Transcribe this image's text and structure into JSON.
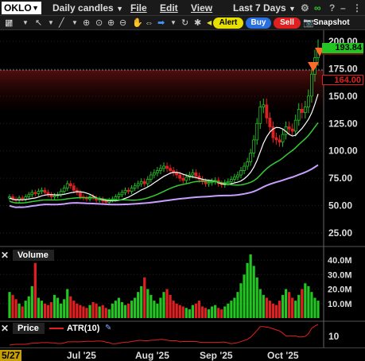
{
  "topbar": {
    "symbol": "OKLO",
    "interval": "Daily candles",
    "menus": [
      "File",
      "Edit",
      "View"
    ],
    "range": "Last 7 Days"
  },
  "toolbar": {
    "alert_label": "Alert",
    "buy_label": "Buy",
    "sell_label": "Sell",
    "snapshot_label": "Snapshot"
  },
  "price_axis": {
    "ticks": [
      "200.00",
      "175.00",
      "150.00",
      "125.00",
      "100.00",
      "75.00",
      "50.00",
      "25.00"
    ],
    "last_price": "193.84",
    "level_label": "164.00",
    "level_label_behind": "168.00",
    "last_price_color": "#22c522",
    "level_color": "#e02020"
  },
  "volume_panel": {
    "tab_label": "Volume",
    "ticks": [
      "40.0M",
      "30.0M",
      "20.0M",
      "10.0M"
    ]
  },
  "indicator_panel": {
    "price_label": "Price",
    "atr_label": "ATR(10)",
    "tick": "10"
  },
  "date_axis": {
    "labels": [
      "5/27",
      "Jul '25",
      "Aug '25",
      "Sep '25",
      "Oct '25"
    ]
  },
  "colors": {
    "up": "#22c522",
    "down": "#e02020",
    "ma_fast": "#ffffff",
    "ma_mid": "#33cc33",
    "ma_slow": "#c9a0ff",
    "atr": "#e02020"
  },
  "chart_data": {
    "type": "candlestick",
    "price_range": [
      20,
      205
    ],
    "volume_range_millions": [
      0,
      45
    ],
    "closes": [
      58,
      56,
      55,
      57,
      56,
      58,
      60,
      62,
      61,
      63,
      64,
      62,
      60,
      58,
      59,
      60,
      63,
      66,
      70,
      68,
      64,
      62,
      58,
      57,
      56,
      58,
      57,
      55,
      56,
      54,
      53,
      55,
      56,
      58,
      60,
      62,
      64,
      63,
      66,
      68,
      70,
      72,
      70,
      74,
      78,
      80,
      82,
      84,
      86,
      84,
      82,
      80,
      78,
      75,
      73,
      76,
      78,
      80,
      77,
      74,
      72,
      70,
      71,
      72,
      73,
      70,
      69,
      71,
      72,
      74,
      76,
      78,
      82,
      86,
      90,
      98,
      110,
      125,
      140,
      142,
      130,
      122,
      112,
      110,
      108,
      115,
      122,
      120,
      118,
      128,
      138,
      135,
      140,
      150,
      170,
      185,
      194
    ],
    "volumes_millions": [
      18,
      16,
      13,
      10,
      8,
      12,
      15,
      22,
      38,
      14,
      12,
      10,
      9,
      11,
      16,
      14,
      10,
      13,
      20,
      15,
      12,
      10,
      9,
      8,
      7,
      9,
      11,
      10,
      8,
      9,
      7,
      6,
      10,
      12,
      14,
      11,
      9,
      10,
      12,
      14,
      18,
      22,
      28,
      20,
      16,
      12,
      10,
      14,
      18,
      20,
      16,
      12,
      10,
      9,
      8,
      7,
      6,
      9,
      10,
      12,
      8,
      7,
      6,
      8,
      9,
      7,
      6,
      8,
      10,
      12,
      14,
      18,
      24,
      30,
      38,
      44,
      36,
      28,
      20,
      16,
      14,
      12,
      10,
      9,
      12,
      16,
      20,
      18,
      14,
      12,
      16,
      20,
      24,
      22,
      18,
      14,
      12
    ]
  }
}
